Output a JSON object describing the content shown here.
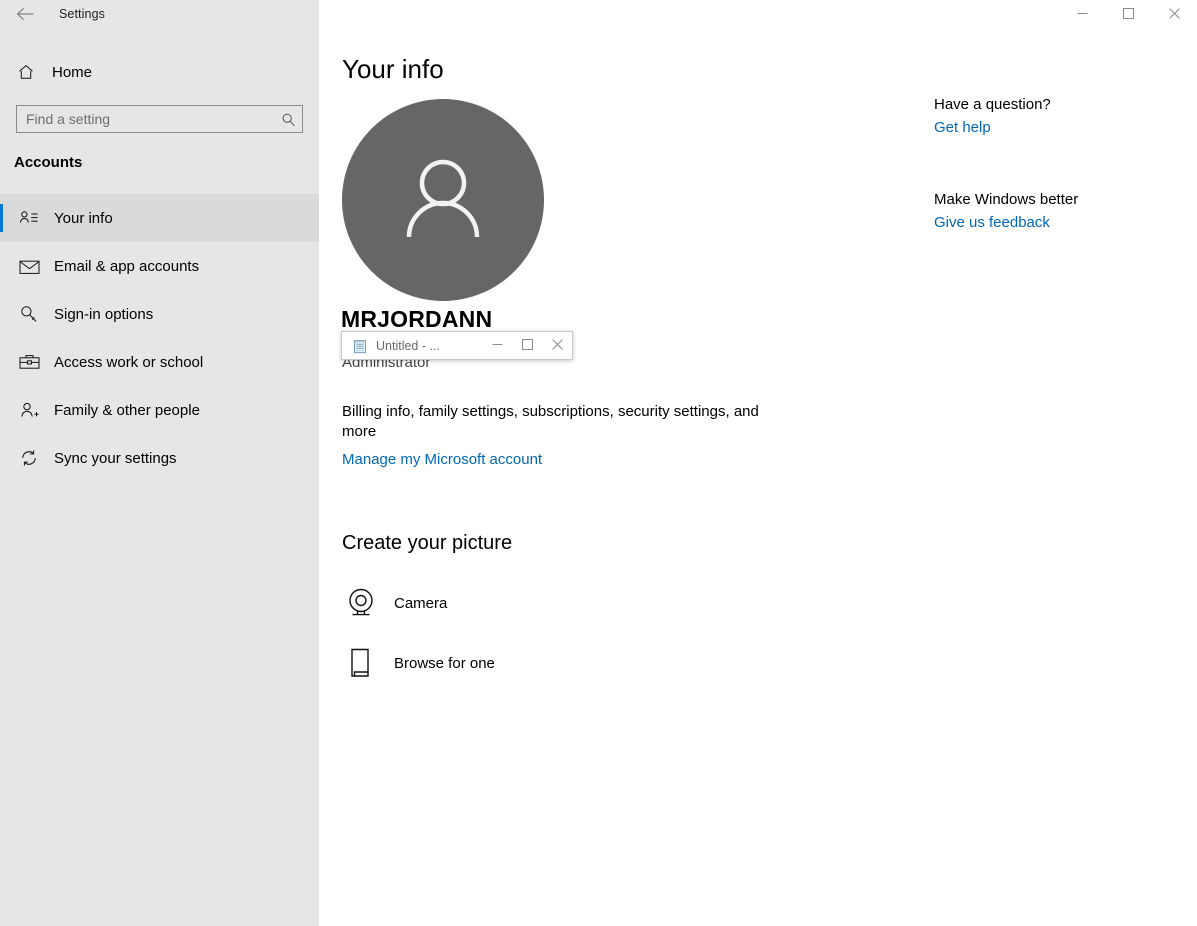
{
  "window": {
    "title": "Settings",
    "back_icon": "back-arrow-icon",
    "controls": {
      "minimize": "minimize-icon",
      "maximize": "maximize-icon",
      "close": "close-icon"
    }
  },
  "sidebar": {
    "home_label": "Home",
    "home_icon": "home-icon",
    "search": {
      "placeholder": "Find a setting",
      "value": "",
      "icon": "search-icon"
    },
    "section_title": "Accounts",
    "accent_color": "#0078d7",
    "background_color": "#e6e6e6",
    "items": [
      {
        "label": "Your info",
        "icon": "contact-card-icon",
        "selected": true
      },
      {
        "label": "Email & app accounts",
        "icon": "mail-icon",
        "selected": false
      },
      {
        "label": "Sign-in options",
        "icon": "key-icon",
        "selected": false
      },
      {
        "label": "Access work or school",
        "icon": "briefcase-icon",
        "selected": false
      },
      {
        "label": "Family & other people",
        "icon": "add-person-icon",
        "selected": false
      },
      {
        "label": "Sync your settings",
        "icon": "sync-icon",
        "selected": false
      }
    ]
  },
  "main": {
    "page_title": "Your info",
    "avatar": {
      "icon": "person-avatar-icon",
      "background_color": "#666666"
    },
    "username": "MRJORDANN",
    "account_email": "",
    "account_role": "Administrator",
    "billing_text": "Billing info, family settings, subscriptions, security settings, and more",
    "manage_link": "Manage my Microsoft account",
    "create_picture_title": "Create your picture",
    "picture_options": [
      {
        "label": "Camera",
        "icon": "webcam-icon"
      },
      {
        "label": "Browse for one",
        "icon": "browse-file-icon"
      }
    ],
    "link_color": "#0067b8"
  },
  "help_rail": {
    "groups": [
      {
        "heading": "Have a question?",
        "link": "Get help"
      },
      {
        "heading": "Make Windows better",
        "link": "Give us feedback"
      }
    ]
  },
  "notepad_window": {
    "title": "Untitled - ...",
    "icon": "notepad-icon",
    "controls": {
      "minimize": "minimize-icon",
      "maximize": "maximize-icon",
      "close": "close-icon"
    }
  }
}
